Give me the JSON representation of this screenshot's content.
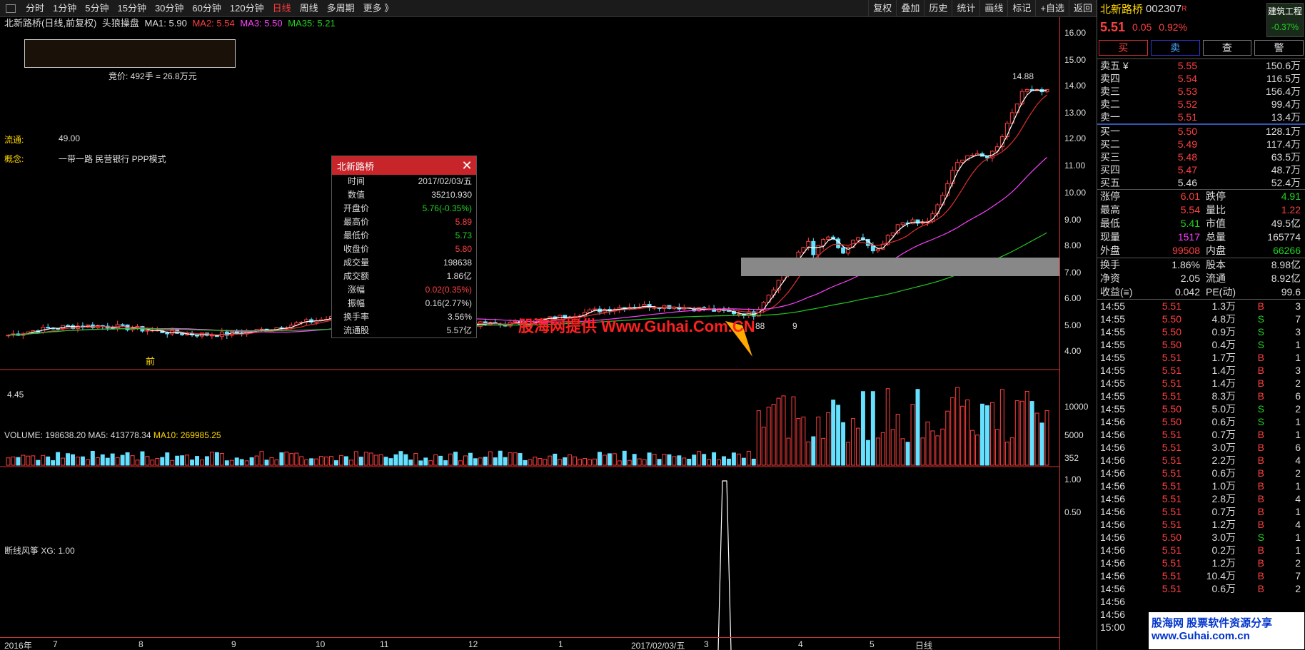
{
  "toolbar": {
    "periods": [
      "分时",
      "1分钟",
      "5分钟",
      "15分钟",
      "30分钟",
      "60分钟",
      "120分钟",
      "日线",
      "周线",
      "多周期",
      "更多 》"
    ],
    "active_period": "日线",
    "tools": [
      "复权",
      "叠加",
      "历史",
      "统计",
      "画线",
      "标记",
      "+自选",
      "返回"
    ]
  },
  "chart_header": {
    "stock_label": "北新路桥(日线,前复权)",
    "indicator": "头狼操盘",
    "ma1": "MA1: 5.90",
    "ma2": "MA2: 5.54",
    "ma3": "MA3: 5.50",
    "ma35": "MA35: 5.21"
  },
  "auction_text": "竞价: 492手 = 26.8万元",
  "float_label": "流通:",
  "float_value": "49.00",
  "concept_label": "概念:",
  "concept_value": "一带一路 民营银行 PPP模式",
  "price_axis": [
    "16.00",
    "15.00",
    "14.00",
    "13.00",
    "12.00",
    "11.00",
    "10.00",
    "9.00",
    "8.00",
    "7.00",
    "6.00",
    "5.00",
    "4.00"
  ],
  "high_marker": "14.88",
  "low_marker": "4.45",
  "buy_tag": "前",
  "mid_marker_left": "88",
  "mid_marker_right": "9",
  "watermark": "股海网提供 Www.Guhai.Com.CN",
  "volume_header": {
    "label": "VOLUME: 198638.20",
    "ma5": "MA5: 413778.34",
    "ma10": "MA10: 269985.25"
  },
  "volume_axis": [
    "10000",
    "5000",
    "352"
  ],
  "signal_header": "断线风筝  XG: 1.00",
  "signal_axis": [
    "1.00",
    "0.50"
  ],
  "x_axis": [
    "2016年",
    "7",
    "8",
    "9",
    "10",
    "11",
    "12",
    "1",
    "2017/02/03/五",
    "3",
    "4",
    "5",
    "日线"
  ],
  "popup": {
    "title": "北新路桥",
    "rows": [
      {
        "k": "时间",
        "v": "2017/02/03/五",
        "c": "white"
      },
      {
        "k": "数值",
        "v": "35210.930",
        "c": "white"
      },
      {
        "k": "开盘价",
        "v": "5.76(-0.35%)",
        "c": "green"
      },
      {
        "k": "最高价",
        "v": "5.89",
        "c": "red"
      },
      {
        "k": "最低价",
        "v": "5.73",
        "c": "green"
      },
      {
        "k": "收盘价",
        "v": "5.80",
        "c": "red"
      },
      {
        "k": "成交量",
        "v": "198638",
        "c": "white"
      },
      {
        "k": "成交额",
        "v": "1.86亿",
        "c": "white"
      },
      {
        "k": "涨幅",
        "v": "0.02(0.35%)",
        "c": "red"
      },
      {
        "k": "振幅",
        "v": "0.16(2.77%)",
        "c": "white"
      },
      {
        "k": "换手率",
        "v": "3.56%",
        "c": "white"
      },
      {
        "k": "流通股",
        "v": "5.57亿",
        "c": "white"
      }
    ]
  },
  "side": {
    "name": "北新路桥",
    "code": "002307",
    "code_flag": "R",
    "sector": "建筑工程",
    "sector_change": "-0.37%",
    "price": "5.51",
    "change": "0.05",
    "change_pct": "0.92%",
    "buttons": [
      "买",
      "卖",
      "查",
      "警"
    ],
    "asks": [
      {
        "l": "卖五 ¥",
        "p": "5.55",
        "v": "150.6万"
      },
      {
        "l": "卖四",
        "p": "5.54",
        "v": "116.5万"
      },
      {
        "l": "卖三",
        "p": "5.53",
        "v": "156.4万"
      },
      {
        "l": "卖二",
        "p": "5.52",
        "v": "99.4万"
      },
      {
        "l": "卖一",
        "p": "5.51",
        "v": "13.4万"
      }
    ],
    "bids": [
      {
        "l": "买一",
        "p": "5.50",
        "v": "128.1万",
        "c": "red"
      },
      {
        "l": "买二",
        "p": "5.49",
        "v": "117.4万",
        "c": "red"
      },
      {
        "l": "买三",
        "p": "5.48",
        "v": "63.5万",
        "c": "red"
      },
      {
        "l": "买四",
        "p": "5.47",
        "v": "48.7万",
        "c": "red"
      },
      {
        "l": "买五",
        "p": "5.46",
        "v": "52.4万",
        "c": "white"
      }
    ],
    "stats": [
      {
        "k": "涨停",
        "v1": "6.01",
        "c1": "red",
        "k2": "跌停",
        "v2": "4.91",
        "c2": "green"
      },
      {
        "k": "最高",
        "v1": "5.54",
        "c1": "red",
        "k2": "量比",
        "v2": "1.22",
        "c2": "red"
      },
      {
        "k": "最低",
        "v1": "5.41",
        "c1": "green",
        "k2": "市值",
        "v2": "49.5亿",
        "c2": "white"
      },
      {
        "k": "现量",
        "v1": "1517",
        "c1": "magenta",
        "k2": "总量",
        "v2": "165774",
        "c2": "white"
      },
      {
        "k": "外盘",
        "v1": "99508",
        "c1": "red",
        "k2": "内盘",
        "v2": "66266",
        "c2": "green"
      }
    ],
    "stats2": [
      {
        "k": "换手",
        "v1": "1.86%",
        "c1": "white",
        "k2": "股本",
        "v2": "8.98亿",
        "c2": "white"
      },
      {
        "k": "净资",
        "v1": "2.05",
        "c1": "white",
        "k2": "流通",
        "v2": "8.92亿",
        "c2": "white"
      },
      {
        "k": "收益(≡)",
        "v1": "0.042",
        "c1": "white",
        "k2": "PE(动)",
        "v2": "99.6",
        "c2": "white"
      }
    ],
    "ticks": [
      {
        "t": "14:55",
        "p": "5.51",
        "v": "1.3万",
        "d": "B",
        "n": "3"
      },
      {
        "t": "14:55",
        "p": "5.50",
        "v": "4.8万",
        "d": "S",
        "n": "7"
      },
      {
        "t": "14:55",
        "p": "5.50",
        "v": "0.9万",
        "d": "S",
        "n": "3"
      },
      {
        "t": "14:55",
        "p": "5.50",
        "v": "0.4万",
        "d": "S",
        "n": "1"
      },
      {
        "t": "14:55",
        "p": "5.51",
        "v": "1.7万",
        "d": "B",
        "n": "1"
      },
      {
        "t": "14:55",
        "p": "5.51",
        "v": "1.4万",
        "d": "B",
        "n": "3"
      },
      {
        "t": "14:55",
        "p": "5.51",
        "v": "1.4万",
        "d": "B",
        "n": "2"
      },
      {
        "t": "14:55",
        "p": "5.51",
        "v": "8.3万",
        "d": "B",
        "n": "6"
      },
      {
        "t": "14:55",
        "p": "5.50",
        "v": "5.0万",
        "d": "S",
        "n": "2"
      },
      {
        "t": "14:56",
        "p": "5.50",
        "v": "0.6万",
        "d": "S",
        "n": "1"
      },
      {
        "t": "14:56",
        "p": "5.51",
        "v": "0.7万",
        "d": "B",
        "n": "1"
      },
      {
        "t": "14:56",
        "p": "5.51",
        "v": "3.0万",
        "d": "B",
        "n": "6"
      },
      {
        "t": "14:56",
        "p": "5.51",
        "v": "2.2万",
        "d": "B",
        "n": "4"
      },
      {
        "t": "14:56",
        "p": "5.51",
        "v": "0.6万",
        "d": "B",
        "n": "2"
      },
      {
        "t": "14:56",
        "p": "5.51",
        "v": "1.0万",
        "d": "B",
        "n": "1"
      },
      {
        "t": "14:56",
        "p": "5.51",
        "v": "2.8万",
        "d": "B",
        "n": "4"
      },
      {
        "t": "14:56",
        "p": "5.51",
        "v": "0.7万",
        "d": "B",
        "n": "1"
      },
      {
        "t": "14:56",
        "p": "5.51",
        "v": "1.2万",
        "d": "B",
        "n": "4"
      },
      {
        "t": "14:56",
        "p": "5.50",
        "v": "3.0万",
        "d": "S",
        "n": "1"
      },
      {
        "t": "14:56",
        "p": "5.51",
        "v": "0.2万",
        "d": "B",
        "n": "1"
      },
      {
        "t": "14:56",
        "p": "5.51",
        "v": "1.2万",
        "d": "B",
        "n": "2"
      },
      {
        "t": "14:56",
        "p": "5.51",
        "v": "10.4万",
        "d": "B",
        "n": "7"
      },
      {
        "t": "14:56",
        "p": "5.51",
        "v": "0.6万",
        "d": "B",
        "n": "2"
      },
      {
        "t": "14:56",
        "p": "",
        "v": "",
        "d": "",
        "n": ""
      },
      {
        "t": "14:56",
        "p": "",
        "v": "",
        "d": "",
        "n": ""
      },
      {
        "t": "15:00",
        "p": "",
        "v": "",
        "d": "",
        "n": ""
      }
    ]
  },
  "logo_text": "股海网 股票软件资源分享 www.Guhai.com.cn",
  "colors": {
    "up": "#ff4040",
    "down": "#66e0ff",
    "ma_white": "#ffffff",
    "ma_red": "#e03030",
    "ma_magenta": "#ff40ff",
    "ma_green": "#22c822",
    "vol_ma5": "#ffffff",
    "vol_ma10": "#ffd700"
  }
}
